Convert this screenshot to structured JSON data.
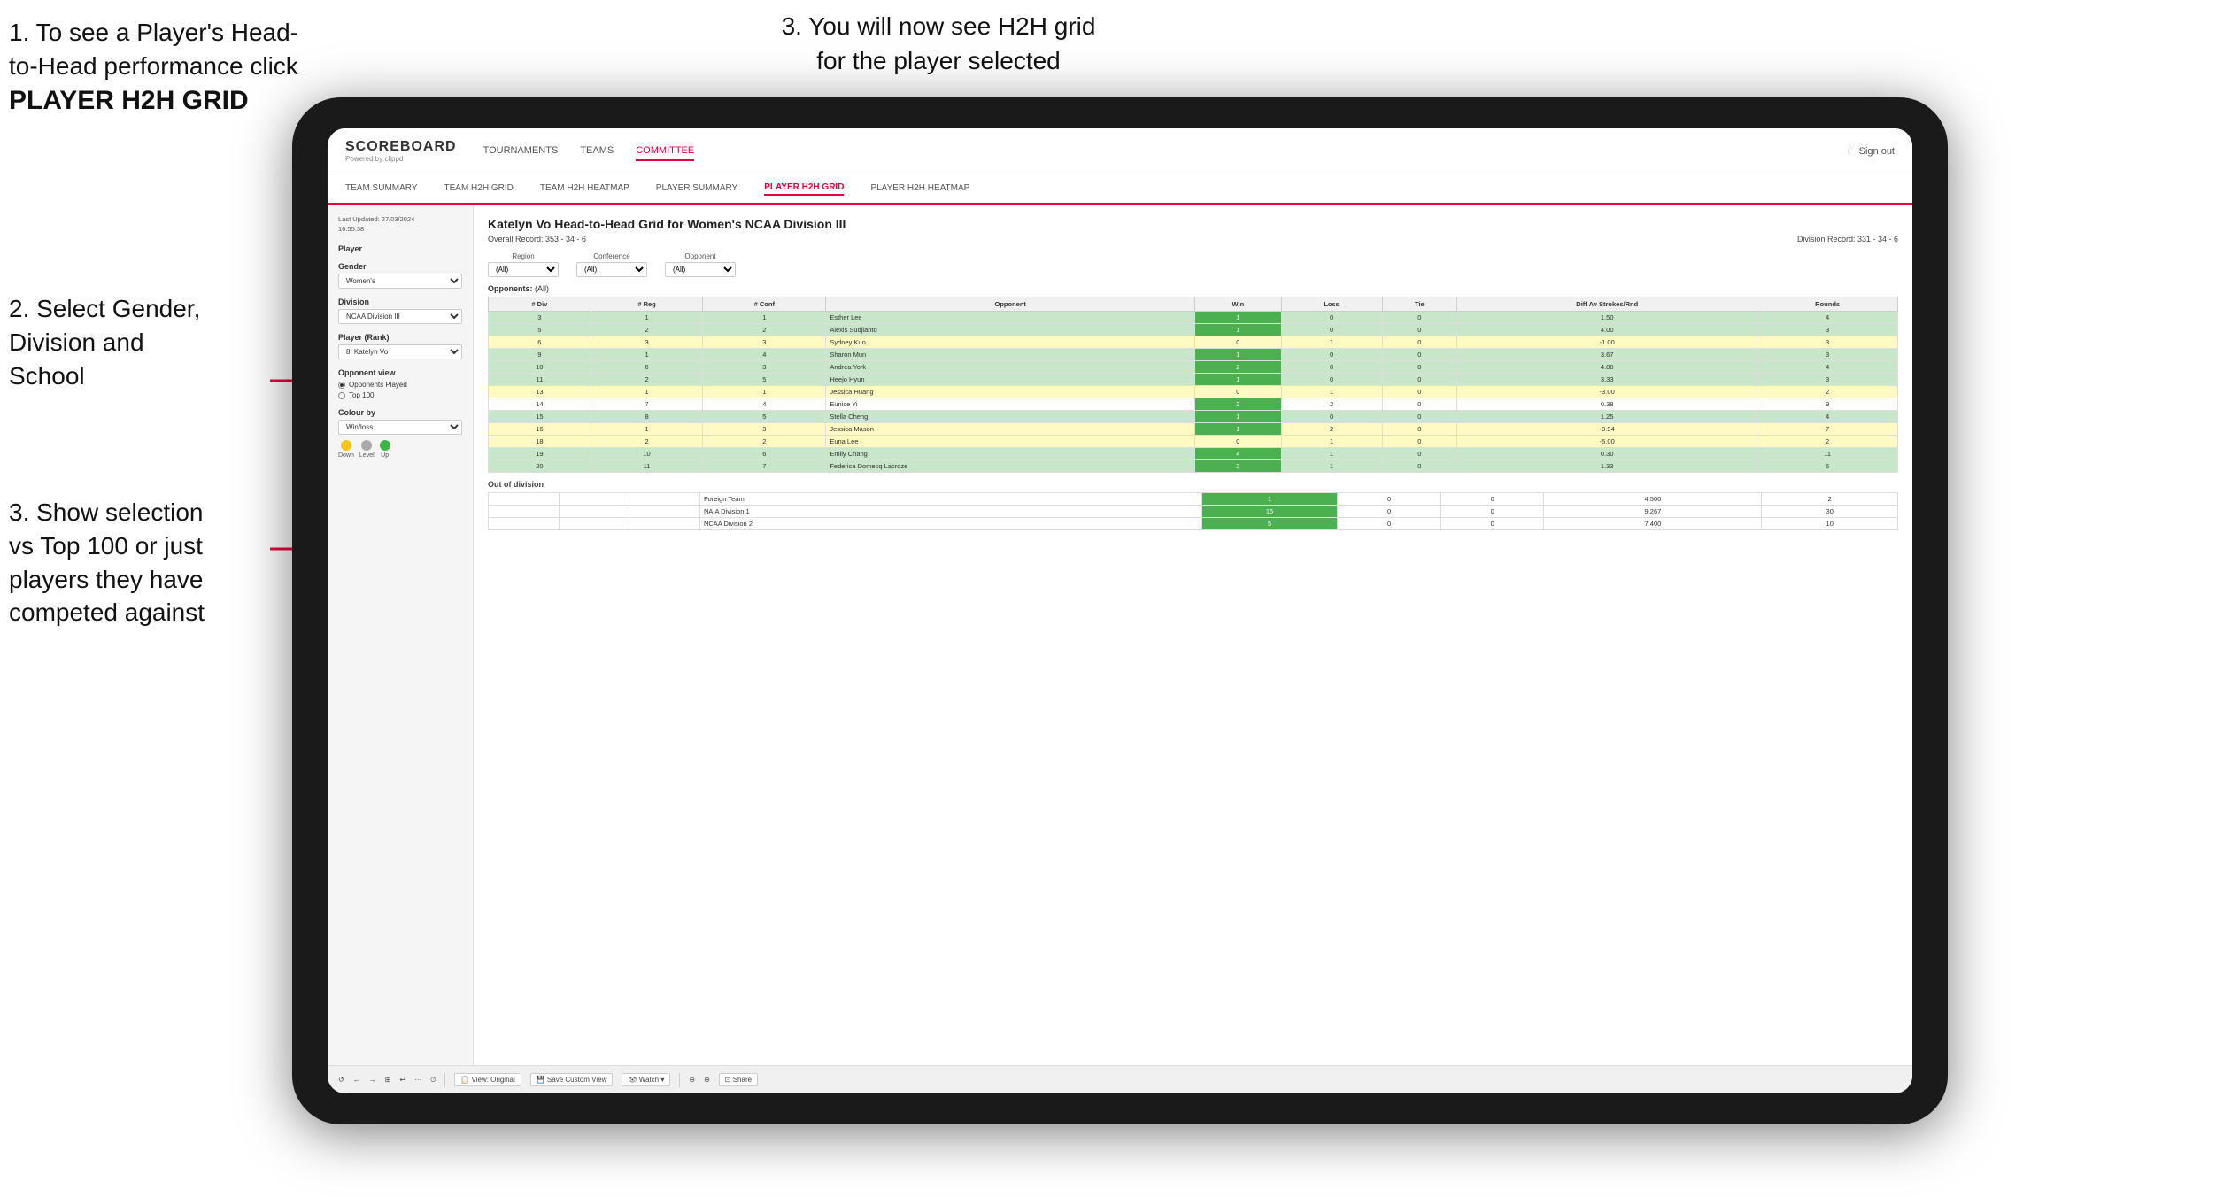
{
  "instructions": {
    "top_left_line1": "1. To see a Player's Head-",
    "top_left_line2": "to-Head performance click",
    "top_left_bold": "PLAYER H2H GRID",
    "top_right": "3. You will now see H2H grid\nfor the player selected",
    "mid_left_line1": "2. Select Gender,",
    "mid_left_line2": "Division and",
    "mid_left_line3": "School",
    "bot_left_line1": "3. Show selection",
    "bot_left_line2": "vs Top 100 or just",
    "bot_left_line3": "players they have",
    "bot_left_line4": "competed against"
  },
  "navbar": {
    "logo": "SCOREBOARD",
    "logo_sub": "Powered by clippd",
    "nav_items": [
      "TOURNAMENTS",
      "TEAMS",
      "COMMITTEE"
    ],
    "nav_right": [
      "i",
      "Sign out"
    ]
  },
  "subnav": {
    "items": [
      "TEAM SUMMARY",
      "TEAM H2H GRID",
      "TEAM H2H HEATMAP",
      "PLAYER SUMMARY",
      "PLAYER H2H GRID",
      "PLAYER H2H HEATMAP"
    ]
  },
  "left_panel": {
    "timestamp": "Last Updated: 27/03/2024\n16:55:38",
    "player_label": "Player",
    "gender_label": "Gender",
    "gender_value": "Women's",
    "division_label": "Division",
    "division_value": "NCAA Division III",
    "player_rank_label": "Player (Rank)",
    "player_rank_value": "8. Katelyn Vo",
    "opponent_view_label": "Opponent view",
    "radio_1": "Opponents Played",
    "radio_2": "Top 100",
    "colour_by_label": "Colour by",
    "colour_by_value": "Win/loss",
    "legend": [
      {
        "label": "Down",
        "color": "yellow"
      },
      {
        "label": "Level",
        "color": "gray"
      },
      {
        "label": "Up",
        "color": "green"
      }
    ]
  },
  "grid": {
    "title": "Katelyn Vo Head-to-Head Grid for Women's NCAA Division III",
    "overall_record": "Overall Record: 353 - 34 - 6",
    "division_record": "Division Record: 331 - 34 - 6",
    "opponents_label": "Opponents:",
    "filter_region": "(All)",
    "filter_conference": "(All)",
    "filter_opponent": "(All)",
    "region_label": "Region",
    "conference_label": "Conference",
    "opponent_label": "Opponent",
    "columns": [
      "# Div",
      "# Reg",
      "# Conf",
      "Opponent",
      "Win",
      "Loss",
      "Tie",
      "Diff Av Strokes/Rnd",
      "Rounds"
    ],
    "rows": [
      {
        "div": "3",
        "reg": "1",
        "conf": "1",
        "name": "Esther Lee",
        "win": "1",
        "loss": "0",
        "tie": "0",
        "diff": "1.50",
        "rounds": "4",
        "color": "green"
      },
      {
        "div": "5",
        "reg": "2",
        "conf": "2",
        "name": "Alexis Sudjianto",
        "win": "1",
        "loss": "0",
        "tie": "0",
        "diff": "4.00",
        "rounds": "3",
        "color": "green"
      },
      {
        "div": "6",
        "reg": "3",
        "conf": "3",
        "name": "Sydney Kuo",
        "win": "0",
        "loss": "1",
        "tie": "0",
        "diff": "-1.00",
        "rounds": "3",
        "color": "yellow"
      },
      {
        "div": "9",
        "reg": "1",
        "conf": "4",
        "name": "Sharon Mun",
        "win": "1",
        "loss": "0",
        "tie": "0",
        "diff": "3.67",
        "rounds": "3",
        "color": "green"
      },
      {
        "div": "10",
        "reg": "6",
        "conf": "3",
        "name": "Andrea York",
        "win": "2",
        "loss": "0",
        "tie": "0",
        "diff": "4.00",
        "rounds": "4",
        "color": "green"
      },
      {
        "div": "11",
        "reg": "2",
        "conf": "5",
        "name": "Heejo Hyun",
        "win": "1",
        "loss": "0",
        "tie": "0",
        "diff": "3.33",
        "rounds": "3",
        "color": "green"
      },
      {
        "div": "13",
        "reg": "1",
        "conf": "1",
        "name": "Jessica Huang",
        "win": "0",
        "loss": "1",
        "tie": "0",
        "diff": "-3.00",
        "rounds": "2",
        "color": "yellow"
      },
      {
        "div": "14",
        "reg": "7",
        "conf": "4",
        "name": "Eunice Yi",
        "win": "2",
        "loss": "2",
        "tie": "0",
        "diff": "0.38",
        "rounds": "9",
        "color": "white"
      },
      {
        "div": "15",
        "reg": "8",
        "conf": "5",
        "name": "Stella Cheng",
        "win": "1",
        "loss": "0",
        "tie": "0",
        "diff": "1.25",
        "rounds": "4",
        "color": "green"
      },
      {
        "div": "16",
        "reg": "1",
        "conf": "3",
        "name": "Jessica Mason",
        "win": "1",
        "loss": "2",
        "tie": "0",
        "diff": "-0.94",
        "rounds": "7",
        "color": "yellow"
      },
      {
        "div": "18",
        "reg": "2",
        "conf": "2",
        "name": "Euna Lee",
        "win": "0",
        "loss": "1",
        "tie": "0",
        "diff": "-5.00",
        "rounds": "2",
        "color": "yellow"
      },
      {
        "div": "19",
        "reg": "10",
        "conf": "6",
        "name": "Emily Chang",
        "win": "4",
        "loss": "1",
        "tie": "0",
        "diff": "0.30",
        "rounds": "11",
        "color": "green"
      },
      {
        "div": "20",
        "reg": "11",
        "conf": "7",
        "name": "Federica Domecq Lacroze",
        "win": "2",
        "loss": "1",
        "tie": "0",
        "diff": "1.33",
        "rounds": "6",
        "color": "green"
      }
    ],
    "out_of_division_label": "Out of division",
    "out_of_division_rows": [
      {
        "name": "Foreign Team",
        "win": "1",
        "loss": "0",
        "tie": "0",
        "diff": "4.500",
        "rounds": "2"
      },
      {
        "name": "NAIA Division 1",
        "win": "15",
        "loss": "0",
        "tie": "0",
        "diff": "9.267",
        "rounds": "30"
      },
      {
        "name": "NCAA Division 2",
        "win": "5",
        "loss": "0",
        "tie": "0",
        "diff": "7.400",
        "rounds": "10"
      }
    ]
  },
  "toolbar": {
    "buttons": [
      "↺",
      "←",
      "→",
      "⊞",
      "↩",
      "·",
      "⏱",
      "View: Original",
      "Save Custom View",
      "Watch ▾",
      "⊕",
      "⊡",
      "Share"
    ]
  }
}
